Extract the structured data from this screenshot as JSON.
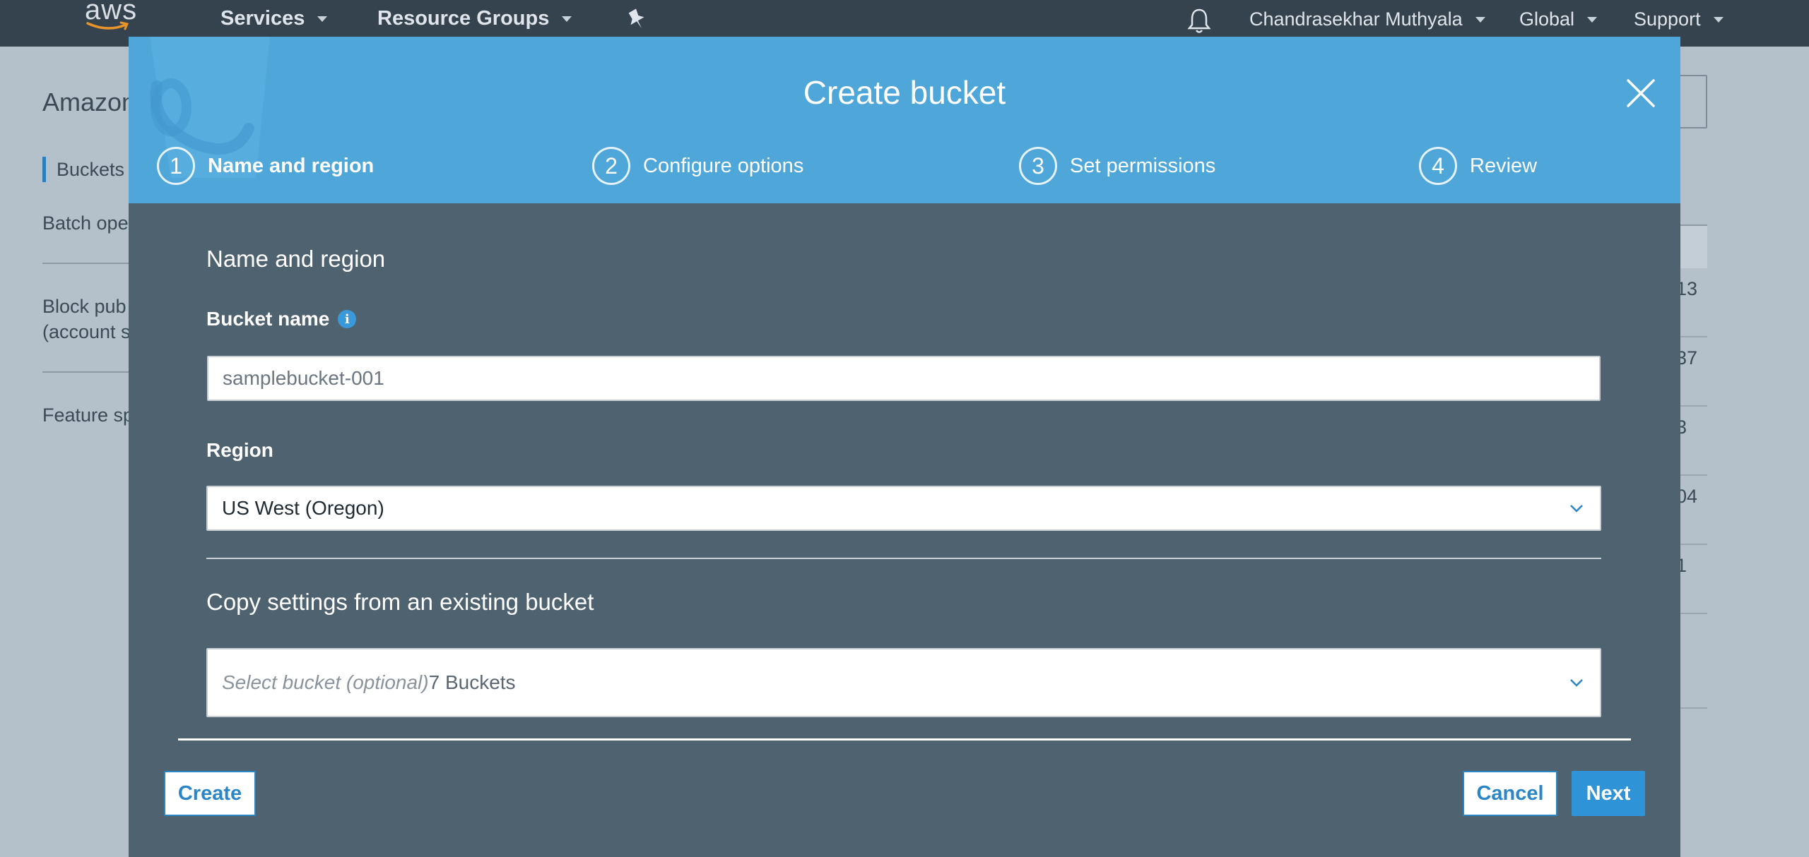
{
  "topnav": {
    "logo_text": "aws",
    "services_label": "Services",
    "resource_groups_label": "Resource Groups",
    "user_label": "Chandrasekhar Muthyala",
    "region_label": "Global",
    "support_label": "Support"
  },
  "background": {
    "title": "Amazon",
    "side_items": [
      "Buckets",
      "Batch ope",
      "Block pub",
      "(account s",
      "Feature sp"
    ],
    "right_cells": [
      "13",
      "37",
      "3",
      "04",
      "1"
    ]
  },
  "modal": {
    "title": "Create bucket",
    "steps": [
      {
        "num": "1",
        "label": "Name and region",
        "active": true
      },
      {
        "num": "2",
        "label": "Configure options",
        "active": false
      },
      {
        "num": "3",
        "label": "Set permissions",
        "active": false
      },
      {
        "num": "4",
        "label": "Review",
        "active": false
      }
    ],
    "section_title": "Name and region",
    "bucket_name_label": "Bucket name",
    "bucket_name_value": "samplebucket-001",
    "region_label": "Region",
    "region_value": "US West (Oregon)",
    "copy_settings_title": "Copy settings from an existing bucket",
    "copy_select_placeholder": "Select bucket (optional)",
    "copy_select_count": "7 Buckets",
    "create_button": "Create",
    "cancel_button": "Cancel",
    "next_button": "Next"
  },
  "colors": {
    "topnav_bg": "#35434f",
    "modal_header_bg": "#4ea6d9",
    "modal_body_bg": "#4f6270",
    "primary_button": "#2f93d7"
  },
  "icons": [
    "aws-smile-logo",
    "chevron-down-icon",
    "pin-icon",
    "bell-icon",
    "close-icon",
    "info-icon"
  ]
}
